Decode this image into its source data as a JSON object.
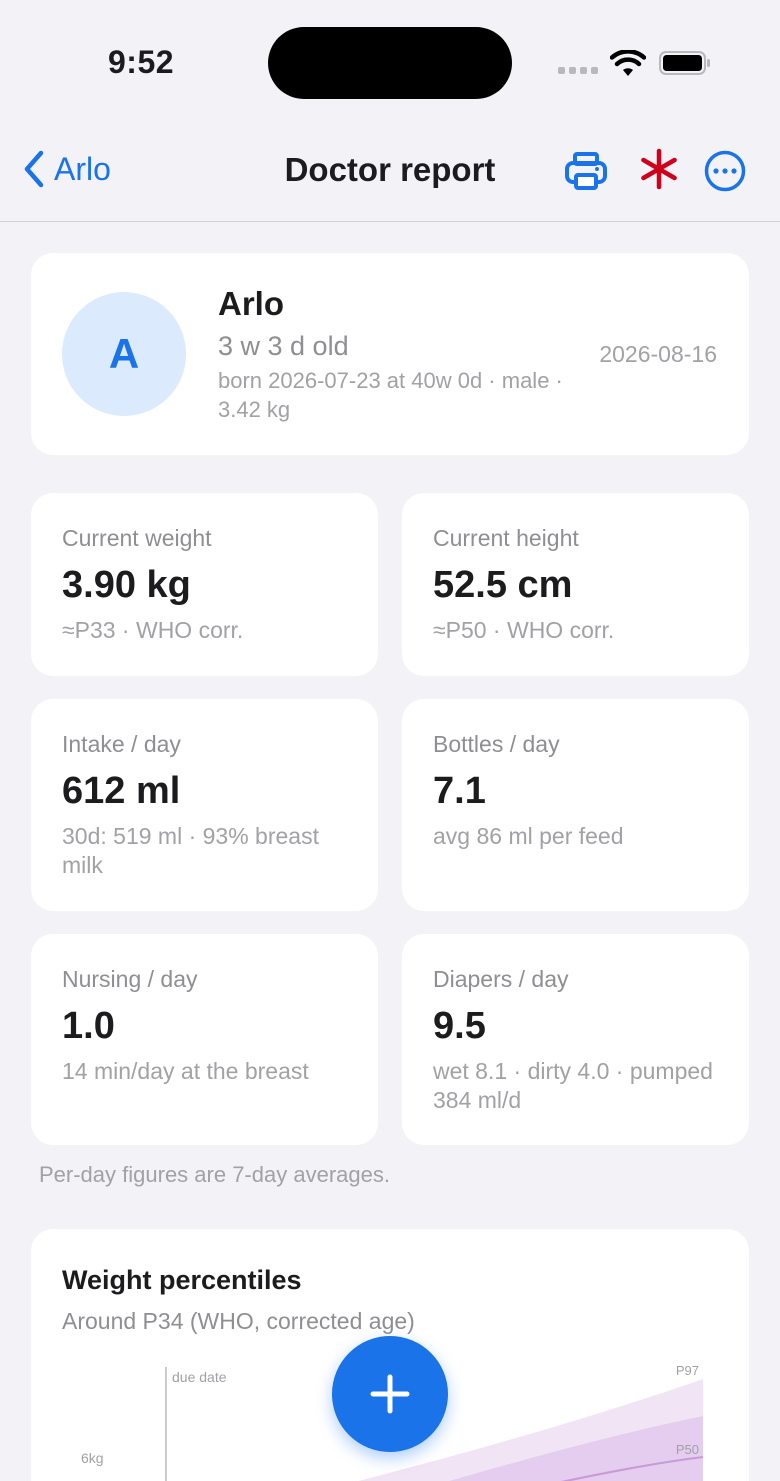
{
  "status": {
    "time": "9:52"
  },
  "nav": {
    "back_label": "Arlo",
    "title": "Doctor report"
  },
  "profile": {
    "initial": "A",
    "name": "Arlo",
    "age": "3 w 3 d old",
    "details": "born 2026-07-23 at 40w 0d · male · 3.42 kg",
    "date": "2026-08-16"
  },
  "stats": [
    {
      "label": "Current weight",
      "value": "3.90 kg",
      "sub": "≈P33 · WHO corr."
    },
    {
      "label": "Current height",
      "value": "52.5 cm",
      "sub": "≈P50 · WHO corr."
    },
    {
      "label": "Intake / day",
      "value": "612 ml",
      "sub": "30d: 519 ml · 93% breast milk"
    },
    {
      "label": "Bottles / day",
      "value": "7.1",
      "sub": "avg 86 ml per feed"
    },
    {
      "label": "Nursing / day",
      "value": "1.0",
      "sub": "14 min/day at the breast"
    },
    {
      "label": "Diapers / day",
      "value": "9.5",
      "sub": "wet 8.1 · dirty 4.0 · pumped 384 ml/d"
    }
  ],
  "note": "Per-day figures are 7-day averages.",
  "chart": {
    "title": "Weight percentiles",
    "subtitle": "Around P34 (WHO, corrected age)",
    "marker_label": "due date",
    "y_tick": "6kg",
    "band_labels": [
      "P97",
      "P50"
    ]
  },
  "colors": {
    "accent": "#1a73e8",
    "asterisk": "#d0021b",
    "band_outer": "#f1e4f5",
    "band_inner": "#e4cdee",
    "median": "#c89bd8"
  },
  "icons": {
    "back": "chevron-left-icon",
    "print": "printer-icon",
    "asterisk": "asterisk-icon",
    "more": "ellipsis-circle-icon",
    "fab": "plus-icon"
  }
}
